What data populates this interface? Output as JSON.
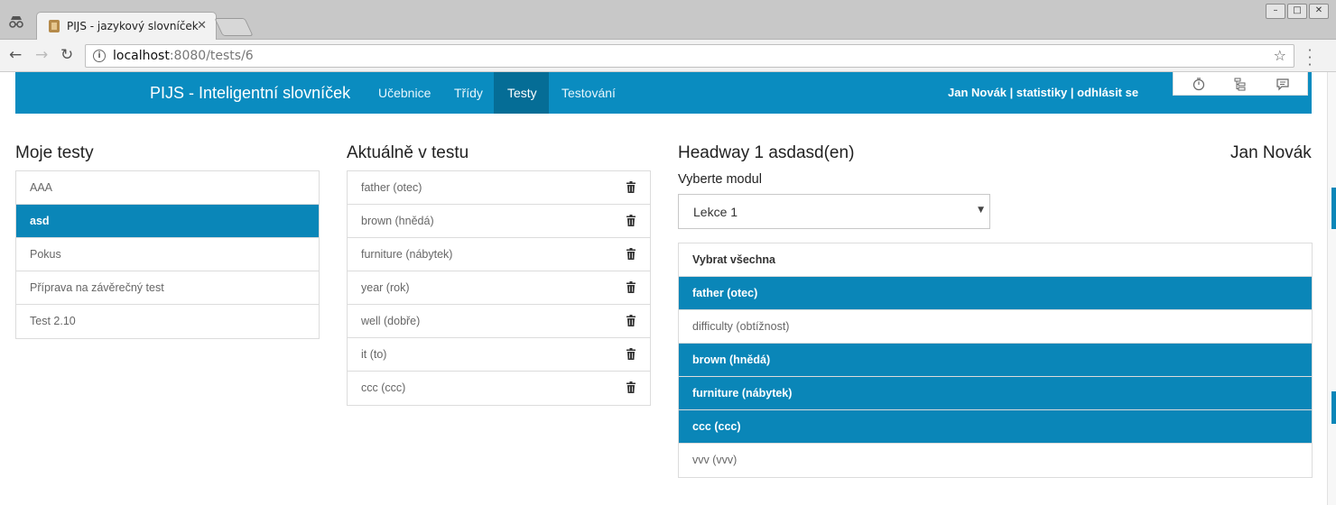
{
  "browser": {
    "tab_title": "PIJS - jazykový slovníček",
    "url_host": "localhost",
    "url_path": ":8080/tests/6"
  },
  "navbar": {
    "brand": "PIJS - Inteligentní slovníček",
    "links": [
      {
        "label": "Učebnice",
        "active": false
      },
      {
        "label": "Třídy",
        "active": false
      },
      {
        "label": "Testy",
        "active": true
      },
      {
        "label": "Testování",
        "active": false
      }
    ],
    "user_name": "Jan Novák",
    "separator": " | ",
    "stats_label": "statistiky",
    "logout_label": "odhlásit se"
  },
  "my_tests": {
    "title": "Moje testy",
    "items": [
      {
        "label": "AAA",
        "active": false
      },
      {
        "label": "asd",
        "active": true
      },
      {
        "label": "Pokus",
        "active": false
      },
      {
        "label": "Příprava na závěrečný test",
        "active": false
      },
      {
        "label": "Test 2.10",
        "active": false
      }
    ]
  },
  "current_test": {
    "title": "Aktuálně v testu",
    "items": [
      "father (otec)",
      "brown (hnědá)",
      "furniture (nábytek)",
      "year (rok)",
      "well (dobře)",
      "it (to)",
      "ccc (ccc)"
    ]
  },
  "module_panel": {
    "title": "Headway 1 asdasd(en)",
    "owner": "Jan Novák",
    "select_label": "Vyberte modul",
    "selected_module": "Lekce 1",
    "words": [
      {
        "label": "Vybrat všechna",
        "active": false,
        "bold": true
      },
      {
        "label": "father (otec)",
        "active": true
      },
      {
        "label": "difficulty (obtížnost)",
        "active": false
      },
      {
        "label": "brown (hnědá)",
        "active": true
      },
      {
        "label": "furniture (nábytek)",
        "active": true
      },
      {
        "label": "ccc (ccc)",
        "active": true
      },
      {
        "label": "vvv (vvv)",
        "active": false
      }
    ]
  },
  "colors": {
    "accent": "#0a86b8",
    "nav_active": "#056d96"
  }
}
